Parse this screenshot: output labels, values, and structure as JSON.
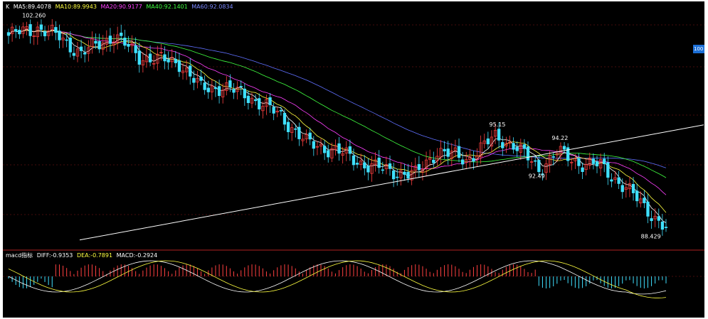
{
  "header": {
    "symbol": "K",
    "ma5": "MA5:89.4078",
    "ma10": "MA10:89.9943",
    "ma20": "MA20:90.9177",
    "ma40": "MA40:92.1401",
    "ma60": "MA60:92.0834"
  },
  "macd_header": {
    "name": "macd指标",
    "diff": "DIFF:-0.9353",
    "dea": "DEA:-0.7891",
    "macd": "MACD:-0.2924"
  },
  "price_tag": "100",
  "colors": {
    "background": "#000000",
    "up": "#ff4040",
    "down": "#3fe0ff",
    "ma5": "#ffffff",
    "ma10": "#ffff40",
    "ma20": "#ff40ff",
    "ma40": "#40ff40",
    "ma60": "#6070ff",
    "diff": "#ffffff",
    "dea": "#ffff40",
    "trendline": "#ffffff",
    "grid": "#8b1a1a"
  },
  "chart_data": {
    "type": "candlestick",
    "ylim": [
      87.7,
      102.9
    ],
    "annotations": [
      "102.260",
      "95.15",
      "94.22",
      "92.49",
      "88.429"
    ],
    "ohlc_key_points": [
      {
        "bar": 0,
        "close": 101.4
      },
      {
        "bar": 8,
        "close": 101.9
      },
      {
        "bar": 14,
        "close": 101.3
      },
      {
        "bar": 20,
        "close": 100.2
      },
      {
        "bar": 29,
        "close": 101.4
      },
      {
        "bar": 36,
        "close": 100.0
      },
      {
        "bar": 47,
        "close": 99.6
      },
      {
        "bar": 53,
        "close": 97.9
      },
      {
        "bar": 59,
        "close": 98.0
      },
      {
        "bar": 66,
        "close": 97.4
      },
      {
        "bar": 75,
        "close": 96.1
      },
      {
        "bar": 82,
        "close": 94.3
      },
      {
        "bar": 90,
        "close": 93.8
      },
      {
        "bar": 98,
        "close": 92.9
      },
      {
        "bar": 104,
        "close": 92.5
      },
      {
        "bar": 112,
        "close": 92.2
      },
      {
        "bar": 118,
        "close": 93.8
      },
      {
        "bar": 126,
        "close": 93.2
      },
      {
        "bar": 134,
        "close": 94.7
      },
      {
        "bar": 139,
        "close": 94.2
      },
      {
        "bar": 146,
        "close": 92.6
      },
      {
        "bar": 151,
        "close": 93.7
      },
      {
        "bar": 157,
        "close": 93.0
      },
      {
        "bar": 163,
        "close": 92.8
      },
      {
        "bar": 170,
        "close": 91.3
      },
      {
        "bar": 176,
        "close": 89.9
      },
      {
        "bar": 181,
        "close": 88.6
      }
    ],
    "macd_histogram_sign": [
      {
        "from": 0,
        "to": 12,
        "sign": "neg"
      },
      {
        "from": 13,
        "to": 48,
        "sign": "pos"
      },
      {
        "from": 49,
        "to": 60,
        "sign": "pos"
      },
      {
        "from": 61,
        "to": 90,
        "sign": "pos"
      },
      {
        "from": 91,
        "to": 130,
        "sign": "pos"
      },
      {
        "from": 131,
        "to": 145,
        "sign": "pos"
      },
      {
        "from": 146,
        "to": 181,
        "sign": "neg"
      }
    ]
  }
}
